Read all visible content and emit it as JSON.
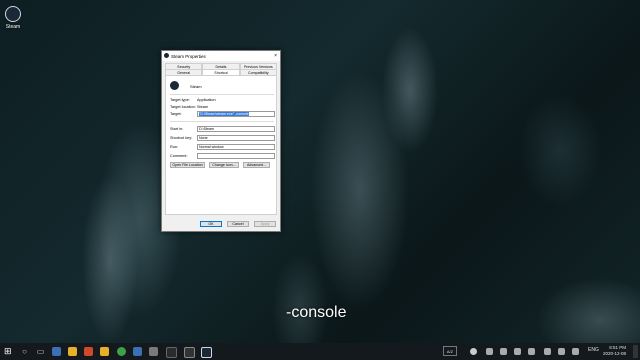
{
  "desktop": {
    "icon_label": "Steam",
    "caption": "-console"
  },
  "dialog": {
    "title": "Steam Properties",
    "close_glyph": "×",
    "tabs_row1": [
      "Security",
      "Details",
      "Previous Versions"
    ],
    "tabs_row2": [
      "General",
      "Shortcut",
      "Compatibility"
    ],
    "app_name": "Steam",
    "target_type_label": "Target type:",
    "target_type_value": "Application",
    "target_location_label": "Target location:",
    "target_location_value": "Steam",
    "target_label": "Target:",
    "target_value": "\"D:\\Steam\\steam.exe\" -console",
    "start_in_label": "Start in:",
    "start_in_value": "D:\\Steam",
    "shortcut_key_label": "Shortcut key:",
    "shortcut_key_value": "None",
    "run_label": "Run:",
    "run_value": "Normal window",
    "comment_label": "Comment:",
    "comment_value": "",
    "open_file_location_label": "Open File Location",
    "change_icon_label": "Change Icon...",
    "advanced_label": "Advanced...",
    "ok_label": "OK",
    "cancel_label": "Cancel",
    "apply_label": "Apply"
  },
  "taskbar": {
    "start_glyph": "⊞",
    "search_glyph": "○",
    "taskview_glyph": "▭",
    "keyboard": "A/Z",
    "lang": "ENG",
    "time": "8:51 PM",
    "date": "2020-12-08"
  }
}
